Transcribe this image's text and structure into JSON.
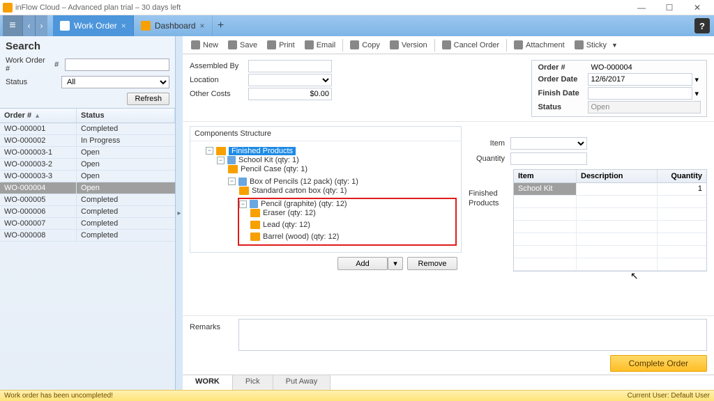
{
  "window": {
    "title": "inFlow Cloud – Advanced plan trial – 30 days left",
    "help": "?"
  },
  "tabs": {
    "active": "Work Order",
    "other": "Dashboard",
    "close": "×",
    "add": "+"
  },
  "search": {
    "heading": "Search",
    "fields": {
      "wo_label": "Work Order #",
      "wo_value": "",
      "hash": "#",
      "status_label": "Status",
      "status_value": "All"
    },
    "refresh": "Refresh",
    "columns": {
      "order": "Order #",
      "status": "Status"
    },
    "rows": [
      {
        "order": "WO-000001",
        "status": "Completed",
        "selected": false
      },
      {
        "order": "WO-000002",
        "status": "In Progress",
        "selected": false
      },
      {
        "order": "WO-000003-1",
        "status": "Open",
        "selected": false
      },
      {
        "order": "WO-000003-2",
        "status": "Open",
        "selected": false
      },
      {
        "order": "WO-000003-3",
        "status": "Open",
        "selected": false
      },
      {
        "order": "WO-000004",
        "status": "Open",
        "selected": true
      },
      {
        "order": "WO-000005",
        "status": "Completed",
        "selected": false
      },
      {
        "order": "WO-000006",
        "status": "Completed",
        "selected": false
      },
      {
        "order": "WO-000007",
        "status": "Completed",
        "selected": false
      },
      {
        "order": "WO-000008",
        "status": "Completed",
        "selected": false
      }
    ]
  },
  "toolbar": {
    "new": "New",
    "save": "Save",
    "print": "Print",
    "email": "Email",
    "copy": "Copy",
    "version": "Version",
    "cancel": "Cancel Order",
    "attachment": "Attachment",
    "sticky": "Sticky"
  },
  "form": {
    "assembled_label": "Assembled By",
    "assembled_value": "",
    "location_label": "Location",
    "location_value": "",
    "other_label": "Other Costs",
    "other_value": "$0.00"
  },
  "info": {
    "order_no_label": "Order #",
    "order_no": "WO-000004",
    "order_date_label": "Order Date",
    "order_date": "12/6/2017",
    "finish_date_label": "Finish Date",
    "finish_date": "",
    "status_label": "Status",
    "status": "Open"
  },
  "components": {
    "title": "Components Structure",
    "root": "Finished Products",
    "tree": {
      "school_kit": "School Kit  (qty: 1)",
      "pencil_case": "Pencil Case  (qty: 1)",
      "box12": "Box of Pencils (12 pack)  (qty: 1)",
      "carton": "Standard carton box  (qty: 1)",
      "pencil": "Pencil (graphite)  (qty: 12)",
      "eraser": "Eraser  (qty: 12)",
      "lead": "Lead  (qty: 12)",
      "barrel": "Barrel (wood)  (qty: 12)"
    },
    "add": "Add",
    "remove": "Remove"
  },
  "rightpane": {
    "item_label": "Item",
    "qty_label": "Quantity",
    "table_label": "Finished\nProducts",
    "headers": {
      "item": "Item",
      "desc": "Description",
      "qty": "Quantity"
    },
    "rows": [
      {
        "item": "School Kit",
        "desc": "",
        "qty": "1"
      }
    ]
  },
  "remarks": {
    "label": "Remarks",
    "value": ""
  },
  "complete": "Complete Order",
  "bottom_tabs": {
    "work": "WORK",
    "pick": "Pick",
    "put_away": "Put Away"
  },
  "status": {
    "left": "Work order has been uncompleted!",
    "right": "Current User:  Default User"
  }
}
